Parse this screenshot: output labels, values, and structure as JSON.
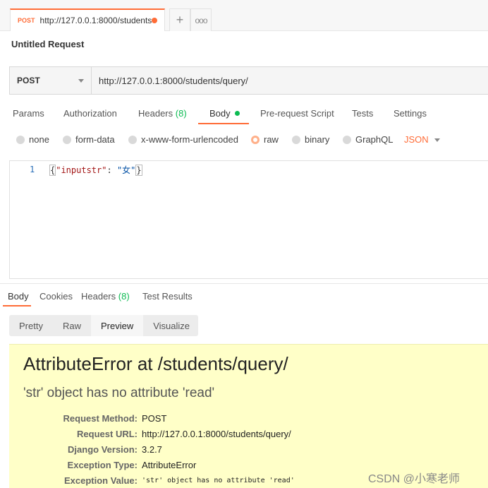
{
  "tab": {
    "method": "POST",
    "title": "http://127.0.0.1:8000/students..."
  },
  "tab_actions": {
    "new": "+",
    "more": "ooo"
  },
  "request": {
    "name": "Untitled Request",
    "method": "POST",
    "url": "http://127.0.0.1:8000/students/query/"
  },
  "request_tabs": [
    {
      "label": "Params"
    },
    {
      "label": "Authorization"
    },
    {
      "label": "Headers",
      "count": "(8)"
    },
    {
      "label": "Body"
    },
    {
      "label": "Pre-request Script"
    },
    {
      "label": "Tests"
    },
    {
      "label": "Settings"
    }
  ],
  "body_types": [
    "none",
    "form-data",
    "x-www-form-urlencoded",
    "raw",
    "binary",
    "GraphQL"
  ],
  "body_format": "JSON",
  "editor": {
    "line_number": "1",
    "code": {
      "open": "{",
      "key": "\"inputstr\"",
      "colon": ": ",
      "value": "\"女\"",
      "close": "}"
    }
  },
  "response_tabs": [
    {
      "label": "Body"
    },
    {
      "label": "Cookies"
    },
    {
      "label": "Headers",
      "count": "(8)"
    },
    {
      "label": "Test Results"
    }
  ],
  "view_modes": [
    "Pretty",
    "Raw",
    "Preview",
    "Visualize"
  ],
  "preview": {
    "title": "AttributeError at /students/query/",
    "subtitle": "'str' object has no attribute 'read'",
    "meta": [
      {
        "label": "Request Method:",
        "value": "POST"
      },
      {
        "label": "Request URL:",
        "value": "http://127.0.0.1:8000/students/query/"
      },
      {
        "label": "Django Version:",
        "value": "3.2.7"
      },
      {
        "label": "Exception Type:",
        "value": "AttributeError"
      },
      {
        "label": "Exception Value:",
        "value": "'str' object has no attribute 'read'"
      }
    ]
  },
  "watermark": "CSDN @小寒老师",
  "colors": {
    "accent": "#ff6c37",
    "count_green": "#0cbb52",
    "preview_bg": "#ffffc8"
  }
}
